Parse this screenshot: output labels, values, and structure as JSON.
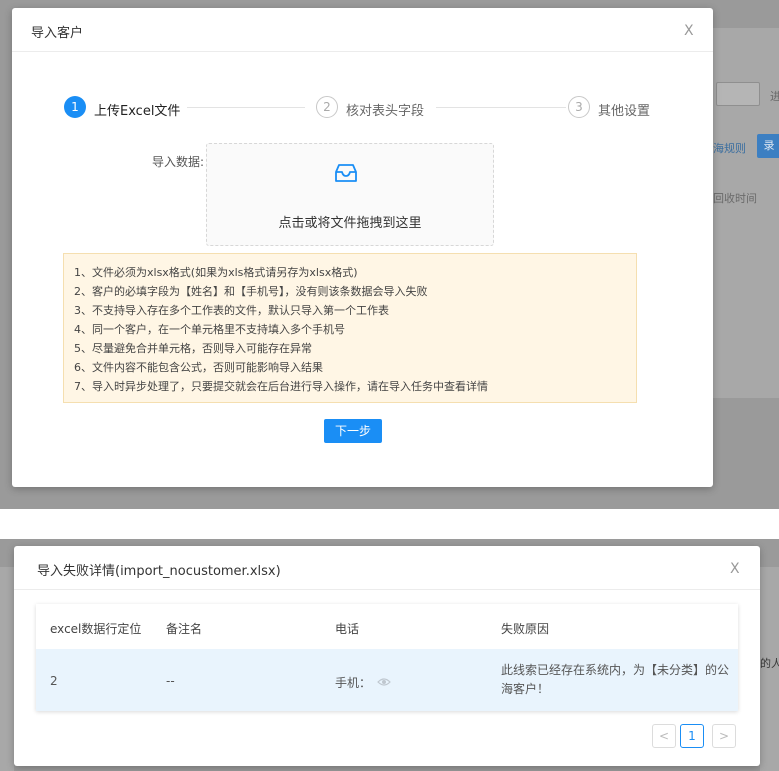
{
  "background_top": {
    "search_suffix": "进",
    "rule_link": "海规则",
    "action_btn": "录",
    "column_header": "回收时间"
  },
  "background_bottom": {
    "side_text": "的人"
  },
  "import_dialog": {
    "title": "导入客户",
    "close": "X",
    "steps": [
      {
        "num": "1",
        "label": "上传Excel文件"
      },
      {
        "num": "2",
        "label": "核对表头字段"
      },
      {
        "num": "3",
        "label": "其他设置"
      }
    ],
    "upload_label": "导入数据:",
    "upload_hint": "点击或将文件拖拽到这里",
    "upload_icon": "inbox-icon",
    "notes": [
      "1、文件必须为xlsx格式(如果为xls格式请另存为xlsx格式)",
      "2、客户的必填字段为【姓名】和【手机号】，没有则该条数据会导入失败",
      "3、不支持导入存在多个工作表的文件，默认只导入第一个工作表",
      "4、同一个客户，在一个单元格里不支持填入多个手机号",
      "5、尽量避免合并单元格，否则导入可能存在异常",
      "6、文件内容不能包含公式，否则可能影响导入结果",
      "7、导入时异步处理了，只要提交就会在后台进行导入操作，请在导入任务中查看详情"
    ],
    "next_button": "下一步",
    "colors": {
      "primary": "#1a8ef5",
      "notice_bg": "#fff6e5"
    }
  },
  "fail_dialog": {
    "title": "导入失败详情(import_nocustomer.xlsx)",
    "close": "X",
    "columns": [
      "excel数据行定位",
      "备注名",
      "电话",
      "失败原因"
    ],
    "rows": [
      {
        "row": "2",
        "remark": "--",
        "phone": "手机：",
        "reason_line1": "此线索已经存在系统内，为【未分类】的公",
        "reason_line2": "海客户！"
      }
    ],
    "pager": {
      "prev": "<",
      "current": "1",
      "next": ">"
    }
  }
}
